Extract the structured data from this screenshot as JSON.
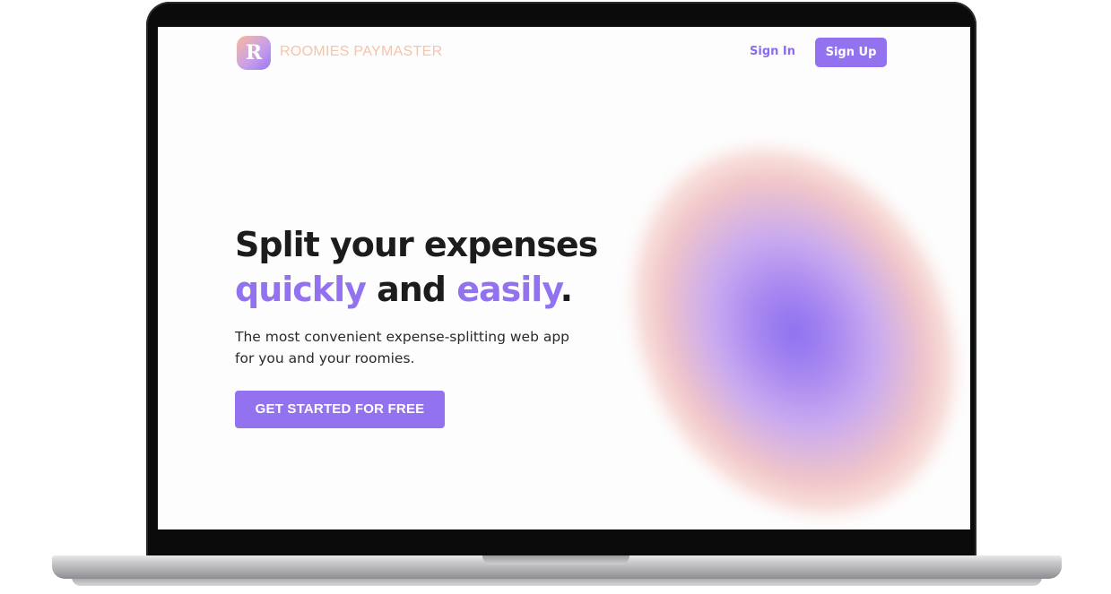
{
  "colors": {
    "accent": "#9372f0",
    "brand_text": "#f5c4ab",
    "headline": "#1c1c1c",
    "bezel": "#0b0b0b"
  },
  "nav": {
    "logo_letter": "R",
    "brand_name": "ROOMIES PAYMASTER",
    "sign_in_label": "Sign In",
    "sign_up_label": "Sign Up"
  },
  "hero": {
    "headline_line1": "Split your expenses",
    "headline_accent1": "quickly",
    "headline_mid": " and ",
    "headline_accent2": "easily",
    "headline_end": ".",
    "subtitle_line1": "The most convenient expense-splitting web app",
    "subtitle_line2": "for you and your roomies.",
    "cta_label": "GET STARTED FOR FREE"
  }
}
